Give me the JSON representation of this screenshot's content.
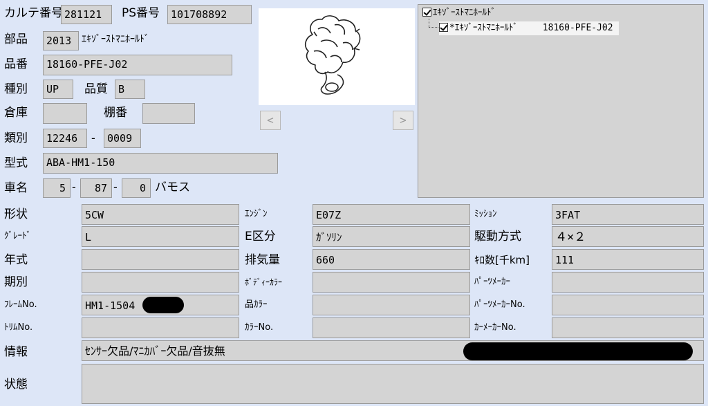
{
  "header": {
    "karte_label": "カルテ番号",
    "karte_value": "281121",
    "ps_label": "PS番号",
    "ps_value": "101708892"
  },
  "part": {
    "label": "部品",
    "code": "2013",
    "name": "ｴｷｿﾞｰｽﾄﾏﾆﾎｰﾙﾄﾞ"
  },
  "part_number": {
    "label": "品番",
    "value": "18160-PFE-J02"
  },
  "type_row": {
    "kind_label": "種別",
    "kind_value": "UP",
    "quality_label": "品質",
    "quality_value": "B"
  },
  "warehouse_row": {
    "warehouse_label": "倉庫",
    "warehouse_value": "",
    "shelf_label": "棚番",
    "shelf_value": ""
  },
  "category_row": {
    "label": "類別",
    "value1": "12246",
    "sep": "-",
    "value2": "0009"
  },
  "model_row": {
    "label": "型式",
    "value": "ABA-HM1-150"
  },
  "car_row": {
    "label": "車名",
    "v1": "5",
    "v2": "87",
    "v3": "0",
    "sep": "-",
    "name": "バモス"
  },
  "image_nav": {
    "prev": "<",
    "next": ">"
  },
  "tree": {
    "root": "ｴｷｿﾞｰｽﾄﾏﾆﾎｰﾙﾄﾞ",
    "child_name": "*ｴｷｿﾞｰｽﾄﾏﾆﾎｰﾙﾄﾞ",
    "child_number": "18160-PFE-J02"
  },
  "spec": {
    "shape_label": "形状",
    "shape_value": "5CW",
    "engine_label": "ｴﾝｼﾞﾝ",
    "engine_value": "E07Z",
    "mission_label": "ﾐｯｼｮﾝ",
    "mission_value": "3FAT",
    "grade_label": "ｸﾞﾚｰﾄﾞ",
    "grade_value": "L",
    "e_class_label": "E区分",
    "e_class_value": "ｶﾞｿﾘﾝ",
    "drive_label": "駆動方式",
    "drive_value": "４×２",
    "year_label": "年式",
    "year_value": "",
    "displacement_label": "排気量",
    "displacement_value": "660",
    "km_label": "ｷﾛ数[千km]",
    "km_value": "111",
    "period_label": "期別",
    "period_value": "",
    "body_color_label": "ﾎﾞﾃﾞｨｰｶﾗｰ",
    "body_color_value": "",
    "parts_maker_label": "ﾊﾟｰﾂﾒｰｶｰ",
    "parts_maker_value": "",
    "frame_label": "ﾌﾚｰﾑNo.",
    "frame_value": "HM1-1504",
    "part_color_label": "品ｶﾗｰ",
    "part_color_value": "",
    "parts_maker_no_label": "ﾊﾟｰﾂﾒｰｶｰNo.",
    "parts_maker_no_value": "",
    "trim_label": "ﾄﾘﾑNo.",
    "trim_value": "",
    "color_no_label": "ｶﾗｰNo.",
    "color_no_value": "",
    "car_maker_no_label": "ｶｰﾒｰｶｰNo.",
    "car_maker_no_value": "",
    "info_label": "情報",
    "info_value": "ｾﾝｻｰ欠品/ﾏﾆｶﾊﾞｰ欠品/音抜無",
    "condition_label": "状態",
    "condition_value": ""
  }
}
